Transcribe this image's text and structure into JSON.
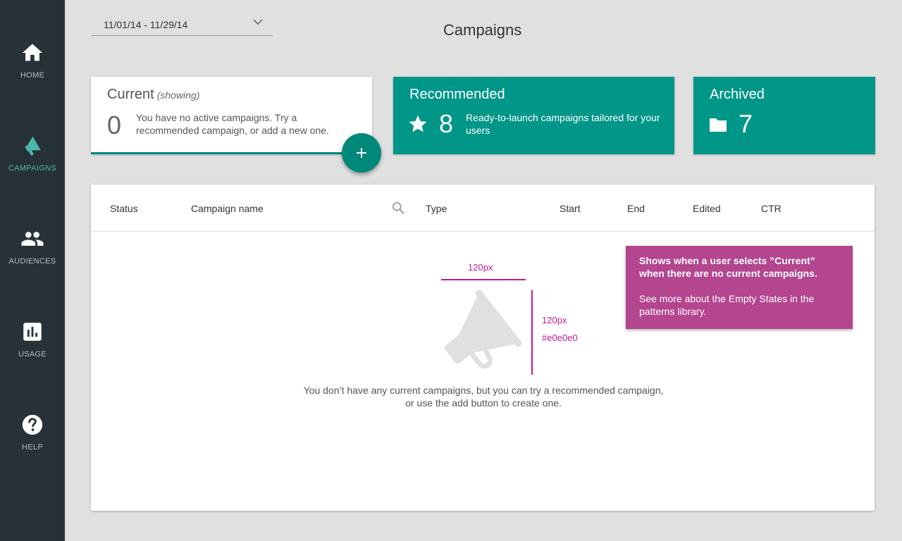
{
  "nav": {
    "items": [
      {
        "label": "HOME",
        "icon": "home-icon"
      },
      {
        "label": "CAMPAIGNS",
        "icon": "megaphone-icon",
        "active": true
      },
      {
        "label": "AUDIENCES",
        "icon": "people-icon"
      },
      {
        "label": "USAGE",
        "icon": "bar-chart-icon"
      },
      {
        "label": "HELP",
        "icon": "help-icon"
      }
    ]
  },
  "date_range": {
    "value": "11/01/14 - 11/29/14"
  },
  "page_title": "Campaigns",
  "cards": {
    "current": {
      "title": "Current",
      "status": "(showing)",
      "count": "0",
      "description": "You have no active campaigns.  Try a recommended campaign, or add a new one."
    },
    "recommended": {
      "title": "Recommended",
      "count": "8",
      "description": "Ready-to-launch campaigns tailored for your users",
      "icon": "star-icon"
    },
    "archived": {
      "title": "Archived",
      "count": "7",
      "icon": "folder-icon"
    }
  },
  "fab": {
    "icon": "plus-icon"
  },
  "table": {
    "columns": [
      "Status",
      "Campaign name",
      "Type",
      "Start",
      "End",
      "Edited",
      "CTR"
    ],
    "empty_message": "You don’t have any current campaigns, but you can try a recommended campaign, or use the add button to create one."
  },
  "spec": {
    "width_label": "120px",
    "height_label": "120px",
    "color_label": "#e0e0e0"
  },
  "note": {
    "bold": "Shows when a user selects ”Current” when there are no current campaigns.",
    "text": "See more about the Empty States in the patterns library."
  },
  "colors": {
    "sidebar": "#263238",
    "accent": "#009688",
    "note": "#b4458f",
    "spec": "#c2189a",
    "empty_icon": "#e0e0e0"
  }
}
